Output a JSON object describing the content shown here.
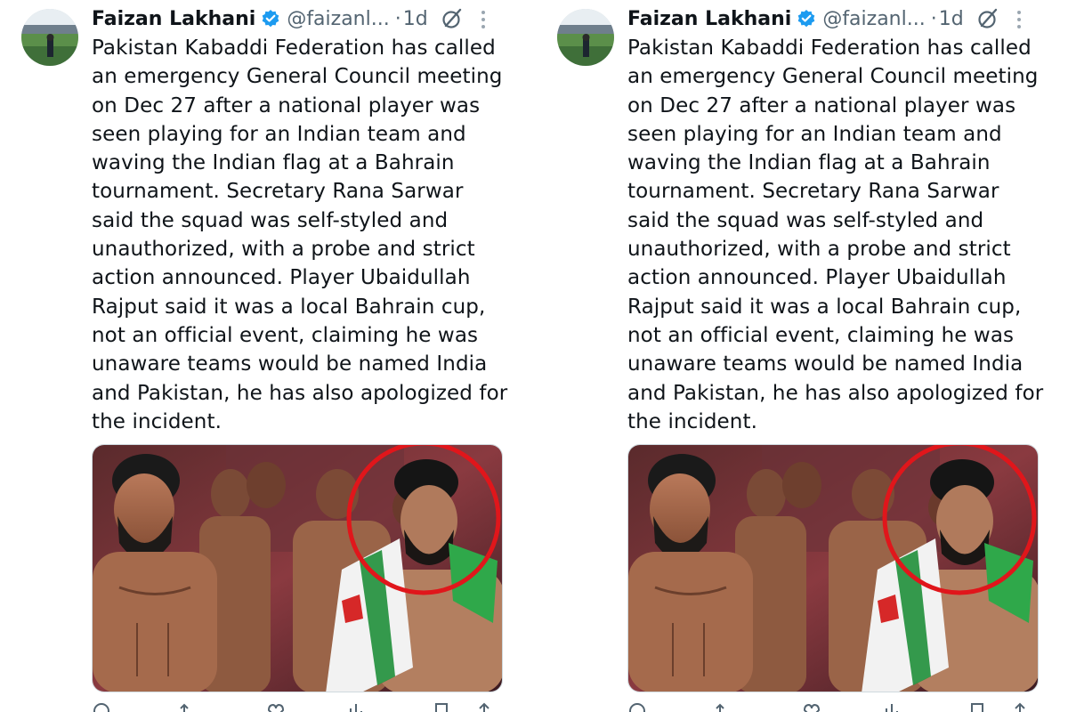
{
  "tweets": [
    {
      "author": {
        "name": "Faizan Lakhani",
        "handle": "@faizanl...",
        "separator": "·",
        "time": "1d"
      },
      "text": "Pakistan Kabaddi Federation has called an emergency General Council meeting on Dec 27 after a national player was seen playing for an Indian team and waving the Indian flag at a Bahrain tournament. Secretary Rana Sarwar said the squad was self-styled and unauthorized, with a probe and strict action announced. Player Ubaidullah Rajput said it was a local Bahrain cup, not an official event, claiming he was unaware teams would be named India and Pakistan, he has also apologized for the incident."
    },
    {
      "author": {
        "name": "Faizan Lakhani",
        "handle": "@faizanl...",
        "separator": "·",
        "time": "1d"
      },
      "text": "Pakistan Kabaddi Federation has called an emergency General Council meeting on Dec 27 after a national player was seen playing for an Indian team and waving the Indian flag at a Bahrain tournament. Secretary Rana Sarwar said the squad was self-styled and unauthorized, with a probe and strict action announced. Player Ubaidullah Rajput said it was a local Bahrain cup, not an official event, claiming he was unaware teams would be named India and Pakistan, he has also apologized for the incident."
    }
  ],
  "icons": {
    "verified": "verified-badge-icon",
    "grok": "grok-icon",
    "more": "more-options-icon",
    "actions": [
      "reply-icon",
      "repost-icon",
      "like-icon",
      "views-icon",
      "bookmark-icon",
      "share-icon"
    ]
  },
  "colors": {
    "text": "#0f1419",
    "secondary": "#536471",
    "verified": "#1d9bf0",
    "highlight_circle": "#e0161b"
  }
}
